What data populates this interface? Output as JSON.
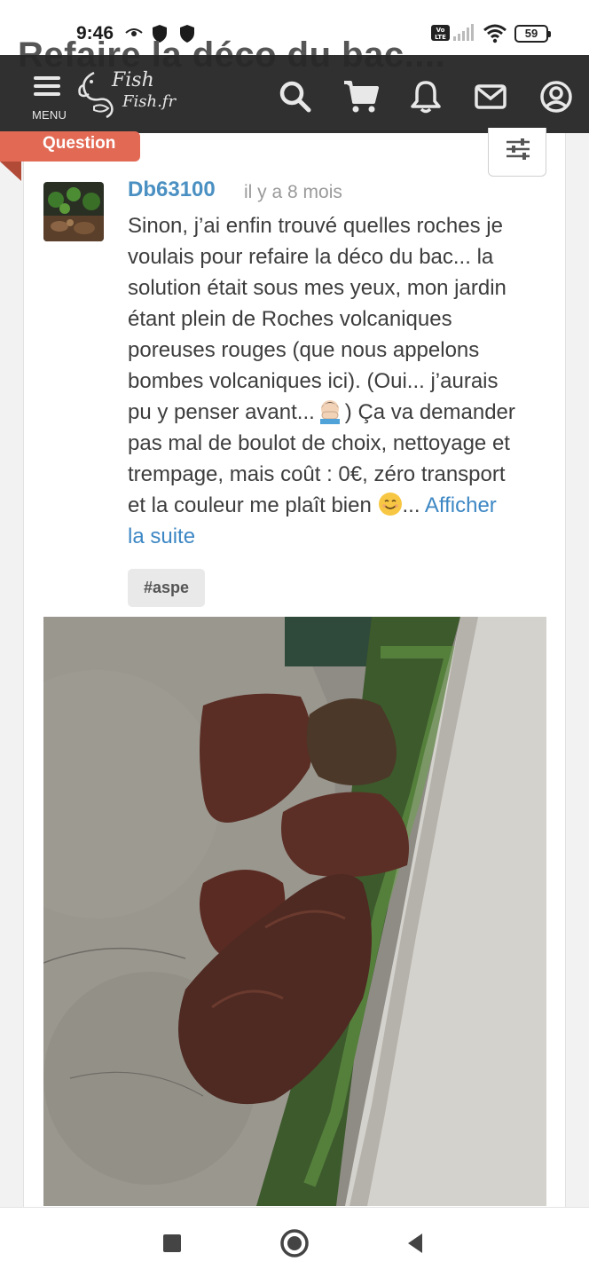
{
  "status_bar": {
    "time": "9:46",
    "battery": "59",
    "icons": [
      "eye-comfort-icon",
      "shield-icon",
      "shield-icon",
      "volte-icon",
      "signal-icon",
      "wifi-icon",
      "battery-icon"
    ]
  },
  "header": {
    "ghost_title": "Refaire la déco du bac....",
    "menu_label": "MENU",
    "logo_line1": "Fish",
    "logo_line2": "Fish.fr",
    "icons": [
      "search-icon",
      "cart-icon",
      "bell-icon",
      "mail-icon",
      "user-icon"
    ]
  },
  "post": {
    "tag": "Question",
    "author": "Db63100",
    "time_ago": "il y a 8 mois",
    "body_lines": [
      "Sinon, j’ai enfin trouvé quelles roches je",
      "voulais pour refaire la déco du bac... la",
      "solution était sous mes yeux, mon jardin",
      "étant plein de Roches volcaniques",
      "poreuses rouges (que nous appelons",
      "bombes volcaniques ici). (Oui... j’aurais",
      "pu y penser avant...",
      ") Ça va demander",
      "pas mal de boulot de choix, nettoyage et",
      "trempage, mais coût : 0€, zéro transport",
      "et la couleur me plaît bien",
      "..."
    ],
    "read_more_1": "Afficher",
    "read_more_2": "la suite",
    "hashtag": "#aspe"
  },
  "colors": {
    "header_bg": "#282828",
    "tag_bg": "#e26a55",
    "link": "#3d87c4",
    "username": "#4a90c2"
  }
}
